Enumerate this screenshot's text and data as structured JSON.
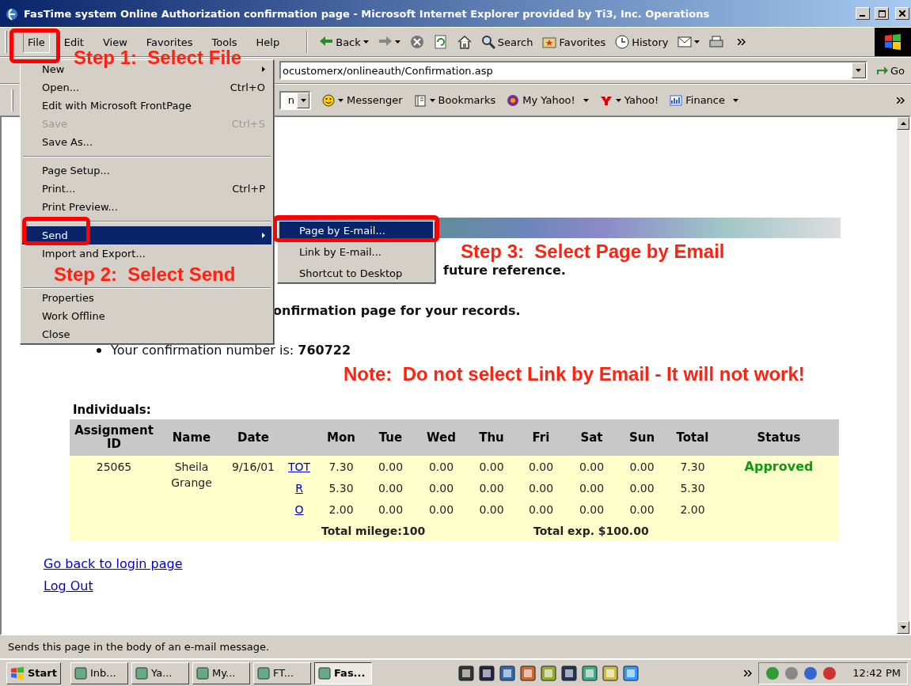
{
  "window": {
    "title": "FasTime system Online Authorization confirmation page - Microsoft Internet Explorer provided by Ti3, Inc. Operations"
  },
  "menu_bar": [
    {
      "label": "File",
      "selected": true
    },
    {
      "label": "Edit",
      "selected": false
    },
    {
      "label": "View",
      "selected": false
    },
    {
      "label": "Favorites",
      "selected": false
    },
    {
      "label": "Tools",
      "selected": false
    },
    {
      "label": "Help",
      "selected": false
    }
  ],
  "toolbar": [
    {
      "kind": "back",
      "label": "Back"
    },
    {
      "kind": "forward"
    },
    {
      "kind": "stop"
    },
    {
      "kind": "refresh"
    },
    {
      "kind": "home"
    },
    {
      "kind": "search",
      "label": "Search"
    },
    {
      "kind": "favorites",
      "label": "Favorites"
    },
    {
      "kind": "history",
      "label": "History"
    },
    {
      "kind": "mail"
    },
    {
      "kind": "print"
    }
  ],
  "address": {
    "value": "ocustomerx/onlineauth/Confirmation.asp",
    "go_label": "Go"
  },
  "links_bar": {
    "search_tail": "n",
    "links": [
      {
        "kind": "messenger",
        "label": "Messenger"
      },
      {
        "kind": "bookmarks",
        "label": "Bookmarks"
      },
      {
        "kind": "myyahoo",
        "label": "My Yahoo!"
      },
      {
        "kind": "yahoo",
        "label": "Yahoo!"
      },
      {
        "kind": "finance",
        "label": "Finance"
      }
    ]
  },
  "file_menu": [
    {
      "kind": "submenu",
      "label": "New",
      "disabled": false,
      "selected": false
    },
    {
      "kind": "item",
      "label": "Open...",
      "shortcut": "Ctrl+O",
      "disabled": false,
      "selected": false
    },
    {
      "kind": "item",
      "label": "Edit with Microsoft FrontPage",
      "disabled": false,
      "selected": false
    },
    {
      "kind": "item",
      "label": "Save",
      "shortcut": "Ctrl+S",
      "disabled": true,
      "selected": false
    },
    {
      "kind": "item",
      "label": "Save As...",
      "disabled": false,
      "selected": false
    },
    {
      "kind": "separator"
    },
    {
      "kind": "item",
      "label": "Page Setup...",
      "disabled": false,
      "selected": false
    },
    {
      "kind": "item",
      "label": "Print...",
      "shortcut": "Ctrl+P",
      "disabled": false,
      "selected": false
    },
    {
      "kind": "item",
      "label": "Print Preview...",
      "disabled": false,
      "selected": false
    },
    {
      "kind": "separator"
    },
    {
      "kind": "submenu",
      "label": "Send",
      "disabled": false,
      "selected": true
    },
    {
      "kind": "item",
      "label": "Import and Export...",
      "disabled": false,
      "selected": false
    },
    {
      "kind": "separator"
    },
    {
      "kind": "item",
      "label": "Properties",
      "disabled": false,
      "selected": false
    },
    {
      "kind": "item",
      "label": "Work Offline",
      "disabled": false,
      "selected": false
    },
    {
      "kind": "item",
      "label": "Close",
      "disabled": false,
      "selected": false
    }
  ],
  "send_submenu": [
    {
      "label": "Page by E-mail...",
      "selected": true
    },
    {
      "label": "Link by E-mail...",
      "selected": false
    },
    {
      "label": "Shortcut to Desktop",
      "selected": false
    }
  ],
  "annotations": [
    "Step 1:  Select File",
    "Step 2:  Select Send",
    "Step 3:  Select Page by Email",
    "Note:  Do not select Link by Email - It will not work!"
  ],
  "page": {
    "lines": [
      "future reference.",
      "onfirmation page for your records."
    ],
    "confirmation": "Your confirmation number is: **760722**",
    "section_title": "Individuals:",
    "table": {
      "columns": [
        "Assignment ID",
        "Name",
        "Date",
        "Mon",
        "Tue",
        "Wed",
        "Thu",
        "Fri",
        "Sat",
        "Sun",
        "Total",
        "Status"
      ],
      "rows": [
        {
          "id": "25065",
          "name": "Sheila Grange",
          "date": "9/16/01",
          "type": "TOT",
          "days": [
            "7.30",
            "0.00",
            "0.00",
            "0.00",
            "0.00",
            "0.00",
            "0.00"
          ],
          "total": "7.30",
          "status": "Approved"
        },
        {
          "type": "R",
          "days": [
            "5.30",
            "0.00",
            "0.00",
            "0.00",
            "0.00",
            "0.00",
            "0.00"
          ],
          "total": "5.30"
        },
        {
          "type": "O",
          "days": [
            "2.00",
            "0.00",
            "0.00",
            "0.00",
            "0.00",
            "0.00",
            "0.00"
          ],
          "total": "2.00"
        }
      ],
      "footer": [
        "Total milege:100",
        "Total exp. $100.00"
      ]
    },
    "links": [
      "Go back to login page",
      "Log Out"
    ]
  },
  "status_bar": "Sends this page in the body of an e-mail message.",
  "taskbar": {
    "start": "Start",
    "tasks": [
      {
        "label": "Inb...",
        "selected": false
      },
      {
        "label": "Ya...",
        "selected": false
      },
      {
        "label": "My...",
        "selected": false
      },
      {
        "label": "FT...",
        "selected": false
      },
      {
        "label": "Fas...",
        "selected": true
      }
    ],
    "clock": "12:42 PM"
  }
}
